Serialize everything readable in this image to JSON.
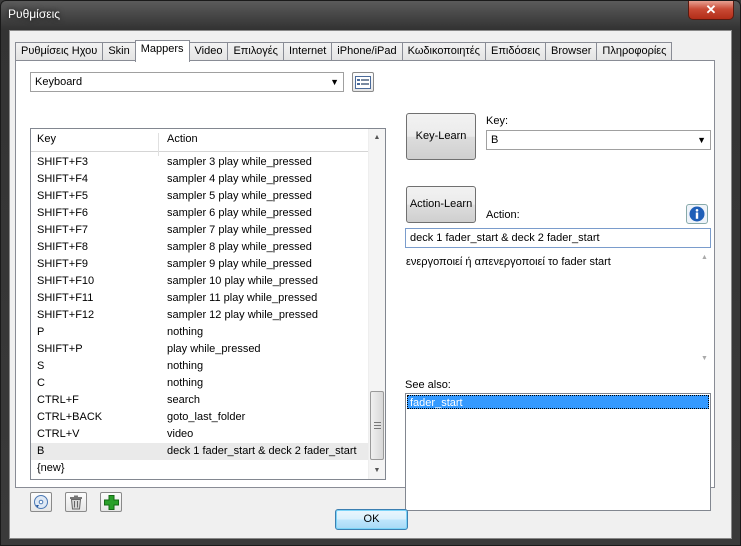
{
  "window": {
    "title": "Ρυθμίσεις",
    "close_glyph": "✕"
  },
  "tabs": [
    {
      "label": "Ρυθμίσεις Ηχου"
    },
    {
      "label": "Skin"
    },
    {
      "label": "Mappers",
      "active": true
    },
    {
      "label": "Video"
    },
    {
      "label": "Επιλογές"
    },
    {
      "label": "Internet"
    },
    {
      "label": "iPhone/iPad"
    },
    {
      "label": "Κωδικοποιητές"
    },
    {
      "label": "Επιδόσεις"
    },
    {
      "label": "Browser"
    },
    {
      "label": "Πληροφορίες"
    }
  ],
  "mapper_select": {
    "value": "Keyboard",
    "arrow": "▼"
  },
  "list_header": {
    "key": "Key",
    "action": "Action"
  },
  "list_rows": [
    {
      "key": "SHIFT+F3",
      "action": "sampler 3 play while_pressed"
    },
    {
      "key": "SHIFT+F4",
      "action": "sampler 4 play while_pressed"
    },
    {
      "key": "SHIFT+F5",
      "action": "sampler 5 play while_pressed"
    },
    {
      "key": "SHIFT+F6",
      "action": "sampler 6 play while_pressed"
    },
    {
      "key": "SHIFT+F7",
      "action": "sampler 7 play while_pressed"
    },
    {
      "key": "SHIFT+F8",
      "action": "sampler 8 play while_pressed"
    },
    {
      "key": "SHIFT+F9",
      "action": "sampler 9 play while_pressed"
    },
    {
      "key": "SHIFT+F10",
      "action": "sampler 10 play while_pressed"
    },
    {
      "key": "SHIFT+F11",
      "action": "sampler 11 play while_pressed"
    },
    {
      "key": "SHIFT+F12",
      "action": "sampler 12 play while_pressed"
    },
    {
      "key": "P",
      "action": "nothing"
    },
    {
      "key": "SHIFT+P",
      "action": "play while_pressed"
    },
    {
      "key": "S",
      "action": "nothing"
    },
    {
      "key": "C",
      "action": "nothing"
    },
    {
      "key": "CTRL+F",
      "action": "search"
    },
    {
      "key": "CTRL+BACK",
      "action": "goto_last_folder"
    },
    {
      "key": "CTRL+V",
      "action": "video"
    },
    {
      "key": "B",
      "action": "deck 1 fader_start & deck 2 fader_start",
      "selected": true
    },
    {
      "key": "{new}",
      "action": ""
    }
  ],
  "buttons": {
    "key_learn": "Key-Learn",
    "action_learn": "Action-Learn",
    "ok": "OK"
  },
  "key_field": {
    "label": "Key:",
    "value": "B",
    "arrow": "▼"
  },
  "action_field": {
    "label": "Action:",
    "value": "deck 1 fader_start & deck 2 fader_start"
  },
  "description": "ενεργοποιεί ή απενεργοποιεί το fader start",
  "see_also": {
    "label": "See also:",
    "items": [
      "fader_start"
    ]
  },
  "colors": {
    "accent": "#3399ff",
    "info": "#1f5fb8",
    "add": "#2aa02a"
  }
}
